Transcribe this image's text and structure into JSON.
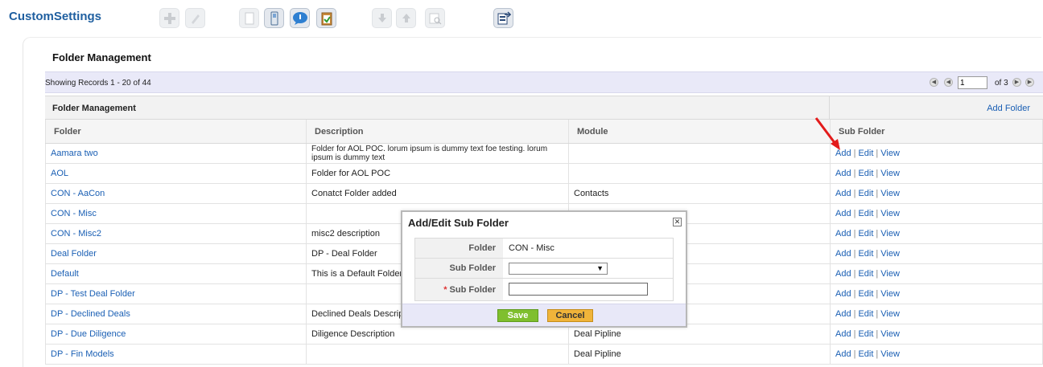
{
  "app": {
    "title": "CustomSettings"
  },
  "toolbar": {
    "buttons": [
      {
        "icon": "add-icon",
        "enabled": false
      },
      {
        "icon": "edit-icon",
        "enabled": false
      },
      {
        "icon": "blank-icon",
        "enabled": false
      },
      {
        "icon": "phone-icon",
        "enabled": true
      },
      {
        "icon": "chat-icon",
        "enabled": true
      },
      {
        "icon": "clipboard-icon",
        "enabled": true
      },
      {
        "icon": "move-down-icon",
        "enabled": false
      },
      {
        "icon": "move-up-icon",
        "enabled": false
      },
      {
        "icon": "search-list-icon",
        "enabled": false
      },
      {
        "icon": "export-icon",
        "enabled": true
      }
    ]
  },
  "panel": {
    "title": "Folder Management"
  },
  "pager": {
    "records_text": "Showing Records 1 - 20 of 44",
    "page_value": "1",
    "of_text": "of 3"
  },
  "grid": {
    "title": "Folder Management",
    "add_folder_label": "Add Folder",
    "columns": [
      "Folder",
      "Description",
      "Module",
      "Sub Folder"
    ],
    "actions": [
      "Add",
      "Edit",
      "View"
    ],
    "rows": [
      {
        "folder": "Aamara two",
        "description": "Folder for AOL POC. lorum ipsum is dummy text foe testing. lorum ipsum is dummy text",
        "module": ""
      },
      {
        "folder": "AOL",
        "description": "Folder for AOL POC",
        "module": ""
      },
      {
        "folder": "CON - AaCon",
        "description": "Conatct Folder added",
        "module": "Contacts"
      },
      {
        "folder": "CON - Misc",
        "description": "",
        "module": ""
      },
      {
        "folder": "CON - Misc2",
        "description": "misc2 description",
        "module": ""
      },
      {
        "folder": "Deal Folder",
        "description": "DP - Deal Folder",
        "module": ""
      },
      {
        "folder": "Default",
        "description": "This is a Default Folder",
        "module": ""
      },
      {
        "folder": "DP - Test Deal Folder",
        "description": "",
        "module": ""
      },
      {
        "folder": "DP - Declined Deals",
        "description": "Declined Deals Description",
        "module": ""
      },
      {
        "folder": "DP - Due Diligence",
        "description": "Diligence Description",
        "module": "Deal Pipline"
      },
      {
        "folder": "DP - Fin Models",
        "description": "",
        "module": "Deal Pipline"
      }
    ]
  },
  "modal": {
    "title": "Add/Edit Sub Folder",
    "close_label": "✕",
    "folder_label": "Folder",
    "folder_value": "CON - Misc",
    "subfolder_select_label": "Sub Folder",
    "subfolder_select_value": "",
    "required_mark": "*",
    "subfolder_input_label": "Sub Folder",
    "subfolder_input_value": "",
    "save_label": "Save",
    "cancel_label": "Cancel"
  },
  "colors": {
    "brand": "#1f5fa0",
    "link": "#1a5fb4",
    "save": "#7fbf2e",
    "cancel": "#f0b43a",
    "annotation_arrow": "#e31b1b"
  }
}
